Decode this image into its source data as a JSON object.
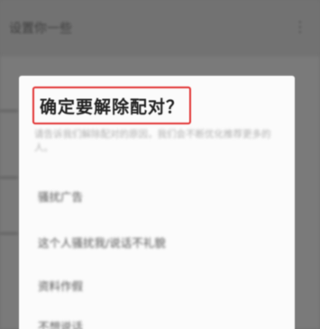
{
  "background": {
    "title": "设置你一些",
    "more_icon": "⋮"
  },
  "dialog": {
    "title": "确定要解除配对？",
    "description": "请告诉我们解除配对的原因，我们会不断优化推荐更多的人。",
    "options": [
      "骚扰广告",
      "这个人骚扰我/说话不礼貌",
      "资料作假",
      "不想说话"
    ]
  },
  "colors": {
    "highlight_border": "#e23535",
    "overlay": "#6f6f6f"
  }
}
